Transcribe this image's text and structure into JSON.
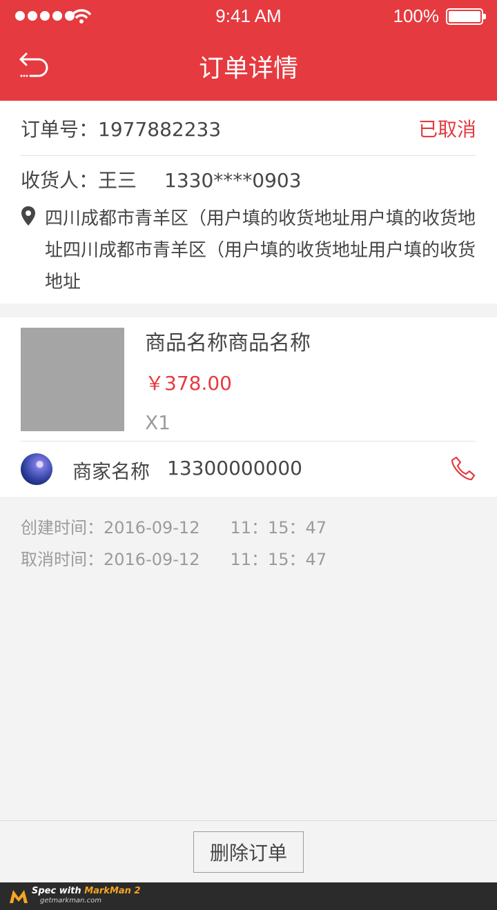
{
  "status_bar": {
    "time": "9:41 AM",
    "battery": "100%"
  },
  "header": {
    "title": "订单详情"
  },
  "order": {
    "number": "订单号：1977882233",
    "status": "已取消",
    "receiver_name": "收货人：王三",
    "receiver_phone": "1330****0903",
    "address": "四川成都市青羊区（用户填的收货地址用户填的收货地址四川成都市青羊区（用户填的收货地址用户填的收货地址"
  },
  "goods": {
    "name": "商品名称商品名称",
    "price": "￥378.00",
    "quantity": "X1"
  },
  "shop": {
    "name": "商家名称",
    "phone": "13300000000"
  },
  "times": {
    "created_label": "创建时间：2016-09-12",
    "created_time": "11：15：47",
    "cancelled_label": "取消时间：2016-09-12",
    "cancelled_time": "11：15：47"
  },
  "actions": {
    "delete_label": "删除订单"
  },
  "footer": {
    "brand_prefix": "Spec with ",
    "brand": "MarkMan 2",
    "url": "getmarkman.com"
  },
  "colors": {
    "accent": "#e53a3f",
    "text": "#464646",
    "muted": "#9b9b9b",
    "background": "#f3f3f3"
  },
  "icons": [
    "signal-dots-icon",
    "wifi-icon",
    "battery-icon",
    "back-icon",
    "location-pin-icon",
    "phone-icon",
    "markman-logo-icon"
  ]
}
